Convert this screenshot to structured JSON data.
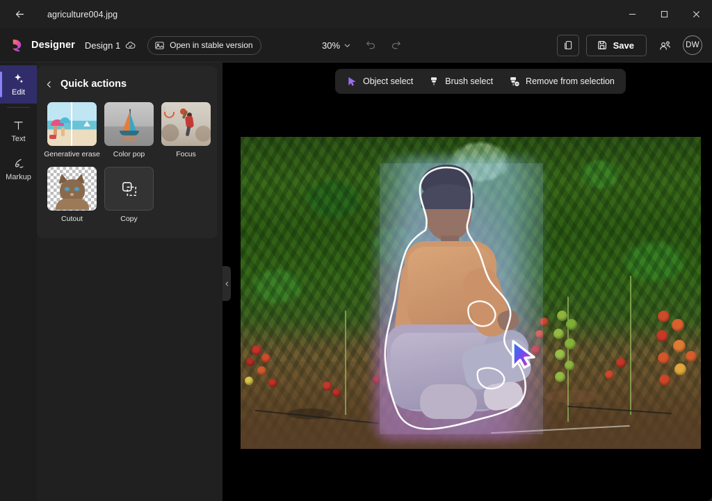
{
  "window": {
    "file_name": "agriculture004.jpg",
    "back_icon": "back-arrow-icon",
    "minimize_label": "–",
    "maximize_label": "□",
    "close_label": "×"
  },
  "header": {
    "app_name": "Designer",
    "design_name": "Design 1",
    "cloud_status_icon": "cloud-saved-icon",
    "stable_version_button": "Open in stable version",
    "stable_version_icon": "image-icon",
    "zoom_level": "30%",
    "zoom_chevron_icon": "chevron-down-icon",
    "undo_icon": "undo-icon",
    "redo_icon": "redo-icon",
    "duplicate_icon": "duplicate-icon",
    "save_label": "Save",
    "save_icon": "save-floppy-icon",
    "share_icon": "share-people-icon",
    "avatar_initials": "DW",
    "accent_color": "#8b82f8",
    "brand_gradient_start": "#f0a 0%"
  },
  "rail": {
    "items": [
      {
        "label": "Edit",
        "icon": "sparkle-icon",
        "active": true
      },
      {
        "label": "Text",
        "icon": "text-t-icon",
        "active": false
      },
      {
        "label": "Markup",
        "icon": "pen-markup-icon",
        "active": false
      }
    ]
  },
  "panel": {
    "back_icon": "chevron-left-icon",
    "title": "Quick actions",
    "actions": [
      {
        "label": "Generative erase",
        "thumb": "beach-before-after-thumb"
      },
      {
        "label": "Color pop",
        "thumb": "sailboat-grayscale-thumb"
      },
      {
        "label": "Focus",
        "thumb": "basketball-player-thumb"
      },
      {
        "label": "Cutout",
        "thumb": "cat-transparent-thumb"
      },
      {
        "label": "Copy",
        "thumb": "copy-icon-tile"
      }
    ],
    "collapse_icon": "chevron-left-icon"
  },
  "toolbar": {
    "items": [
      {
        "label": "Object select",
        "icon": "cursor-arrow-icon"
      },
      {
        "label": "Brush select",
        "icon": "brush-icon"
      },
      {
        "label": "Remove from selection",
        "icon": "brush-minus-icon"
      }
    ]
  },
  "canvas": {
    "cursor_icon": "gradient-cursor-icon",
    "selection_state": "subject-selected",
    "image_subject": "woman crouching among tomato plants"
  }
}
